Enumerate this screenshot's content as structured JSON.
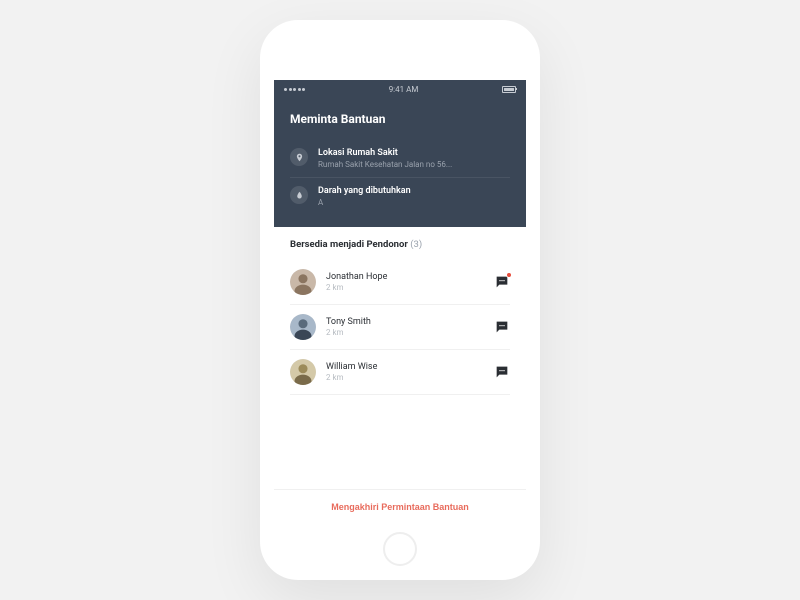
{
  "status_bar": {
    "time": "9:41 AM"
  },
  "header": {
    "title": "Meminta Bantuan",
    "location": {
      "label": "Lokasi Rumah Sakit",
      "value": "Rumah Sakit Kesehatan Jalan no 56..."
    },
    "blood": {
      "label": "Darah yang dibutuhkan",
      "value": "A"
    }
  },
  "donors": {
    "title": "Bersedia menjadi Pendonor",
    "count": "(3)",
    "items": [
      {
        "name": "Jonathan Hope",
        "distance": "2 km",
        "has_unread": true
      },
      {
        "name": "Tony Smith",
        "distance": "2 km",
        "has_unread": false
      },
      {
        "name": "William Wise",
        "distance": "2 km",
        "has_unread": false
      }
    ]
  },
  "footer": {
    "end_label": "Mengakhiri Permintaan Bantuan"
  }
}
